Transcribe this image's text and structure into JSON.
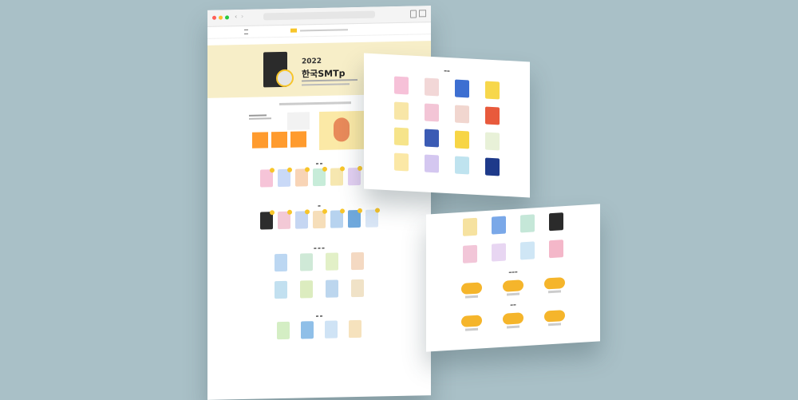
{
  "hero": {
    "year": "2022",
    "title": "한국SMTp"
  },
  "colors": {
    "background": "#a9c0c7",
    "accent_yellow": "#f7c52a",
    "accent_orange": "#ff9b2e",
    "hero_bg": "#f7eec8"
  },
  "icons": {
    "browser_close": "close-dot-icon",
    "browser_min": "minimize-dot-icon",
    "browser_max": "maximize-dot-icon",
    "back": "chevron-left-icon",
    "forward": "chevron-right-icon",
    "share": "share-icon",
    "tabs": "tabs-icon"
  }
}
